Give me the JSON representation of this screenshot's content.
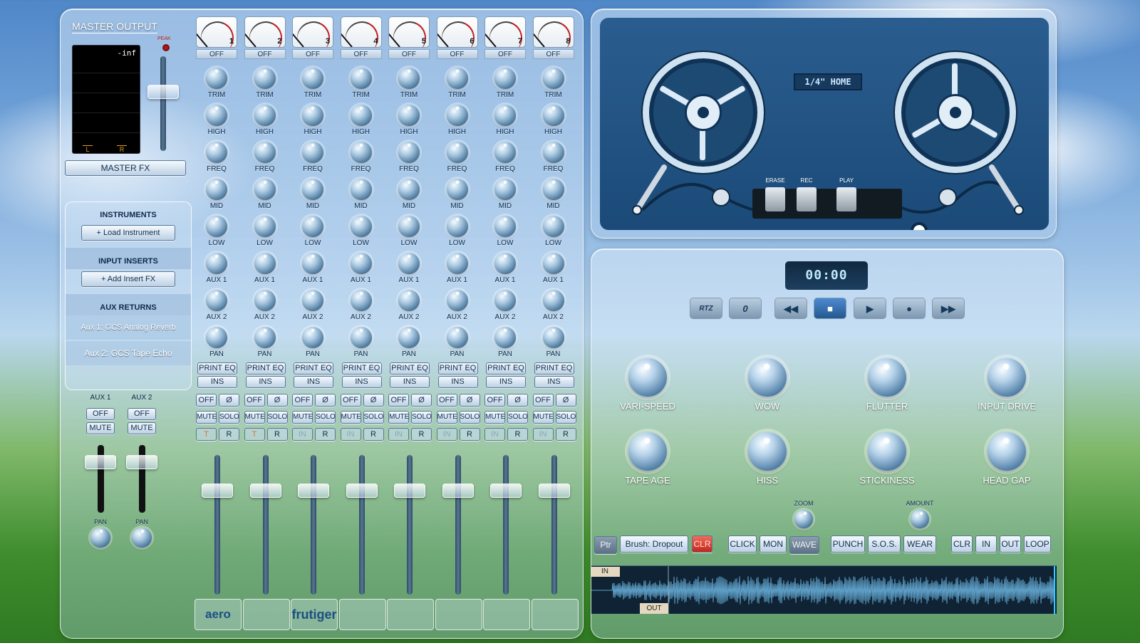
{
  "master": {
    "title": "MASTER OUTPUT",
    "peak": "PEAK",
    "meter_value": "-inf",
    "left": "L",
    "right": "R",
    "fx_button": "MASTER FX"
  },
  "side": {
    "instruments_header": "INSTRUMENTS",
    "load_instrument": "+ Load Instrument",
    "inserts_header": "INPUT INSERTS",
    "add_insert": "+ Add Insert FX",
    "aux_header": "AUX RETURNS",
    "aux1_item": "Aux 1: GCS Analog Reverb",
    "aux2_item": "Aux 2: GCS Tape Echo"
  },
  "aux_returns": [
    {
      "name": "AUX 1",
      "off": "OFF",
      "mute": "MUTE",
      "pan": "PAN"
    },
    {
      "name": "AUX 2",
      "off": "OFF",
      "mute": "MUTE",
      "pan": "PAN"
    }
  ],
  "channels": [
    {
      "num": "1",
      "off": "OFF",
      "trim": "TRIM",
      "high": "HIGH",
      "freq": "FREQ",
      "mid": "MID",
      "low": "LOW",
      "aux1": "AUX 1",
      "aux2": "AUX 2",
      "pan": "PAN",
      "print_eq": "PRINT EQ",
      "ins": "INS",
      "off2": "OFF",
      "phase": "Ø",
      "mute": "MUTE",
      "solo": "SOLO",
      "t": "T",
      "r": "R",
      "strip_label": "aero"
    },
    {
      "num": "2",
      "off": "OFF",
      "trim": "TRIM",
      "high": "HIGH",
      "freq": "FREQ",
      "mid": "MID",
      "low": "LOW",
      "aux1": "AUX 1",
      "aux2": "AUX 2",
      "pan": "PAN",
      "print_eq": "PRINT EQ",
      "ins": "INS",
      "off2": "OFF",
      "phase": "Ø",
      "mute": "MUTE",
      "solo": "SOLO",
      "t": "T",
      "r": "R",
      "strip_label": ""
    },
    {
      "num": "3",
      "off": "OFF",
      "trim": "TRIM",
      "high": "HIGH",
      "freq": "FREQ",
      "mid": "MID",
      "low": "LOW",
      "aux1": "AUX 1",
      "aux2": "AUX 2",
      "pan": "PAN",
      "print_eq": "PRINT EQ",
      "ins": "INS",
      "off2": "OFF",
      "phase": "Ø",
      "mute": "MUTE",
      "solo": "SOLO",
      "t": "IN",
      "r": "R",
      "strip_label": "frutiger"
    },
    {
      "num": "4",
      "off": "OFF",
      "trim": "TRIM",
      "high": "HIGH",
      "freq": "FREQ",
      "mid": "MID",
      "low": "LOW",
      "aux1": "AUX 1",
      "aux2": "AUX 2",
      "pan": "PAN",
      "print_eq": "PRINT EQ",
      "ins": "INS",
      "off2": "OFF",
      "phase": "Ø",
      "mute": "MUTE",
      "solo": "SOLO",
      "t": "IN",
      "r": "R",
      "strip_label": ""
    },
    {
      "num": "5",
      "off": "OFF",
      "trim": "TRIM",
      "high": "HIGH",
      "freq": "FREQ",
      "mid": "MID",
      "low": "LOW",
      "aux1": "AUX 1",
      "aux2": "AUX 2",
      "pan": "PAN",
      "print_eq": "PRINT EQ",
      "ins": "INS",
      "off2": "OFF",
      "phase": "Ø",
      "mute": "MUTE",
      "solo": "SOLO",
      "t": "IN",
      "r": "R",
      "strip_label": ""
    },
    {
      "num": "6",
      "off": "OFF",
      "trim": "TRIM",
      "high": "HIGH",
      "freq": "FREQ",
      "mid": "MID",
      "low": "LOW",
      "aux1": "AUX 1",
      "aux2": "AUX 2",
      "pan": "PAN",
      "print_eq": "PRINT EQ",
      "ins": "INS",
      "off2": "OFF",
      "phase": "Ø",
      "mute": "MUTE",
      "solo": "SOLO",
      "t": "IN",
      "r": "R",
      "strip_label": ""
    },
    {
      "num": "7",
      "off": "OFF",
      "trim": "TRIM",
      "high": "HIGH",
      "freq": "FREQ",
      "mid": "MID",
      "low": "LOW",
      "aux1": "AUX 1",
      "aux2": "AUX 2",
      "pan": "PAN",
      "print_eq": "PRINT EQ",
      "ins": "INS",
      "off2": "OFF",
      "phase": "Ø",
      "mute": "MUTE",
      "solo": "SOLO",
      "t": "IN",
      "r": "R",
      "strip_label": ""
    },
    {
      "num": "8",
      "off": "OFF",
      "trim": "TRIM",
      "high": "HIGH",
      "freq": "FREQ",
      "mid": "MID",
      "low": "LOW",
      "aux1": "AUX 1",
      "aux2": "AUX 2",
      "pan": "PAN",
      "print_eq": "PRINT EQ",
      "ins": "INS",
      "off2": "OFF",
      "phase": "Ø",
      "mute": "MUTE",
      "solo": "SOLO",
      "t": "IN",
      "r": "R",
      "strip_label": ""
    }
  ],
  "tape": {
    "format": "1/4\" HOME",
    "erase": "ERASE",
    "rec": "REC",
    "play": "PLAY"
  },
  "transport": {
    "time": "00:00",
    "rtz": "RTZ",
    "zero": "0",
    "rewind": "◀◀",
    "stop": "■",
    "play": "▶",
    "record": "●",
    "ffwd": "▶▶"
  },
  "tape_knobs": [
    {
      "label": "VARI-SPEED"
    },
    {
      "label": "WOW"
    },
    {
      "label": "FLUTTER"
    },
    {
      "label": "INPUT DRIVE"
    },
    {
      "label": "TAPE AGE"
    },
    {
      "label": "HISS"
    },
    {
      "label": "STICKINESS"
    },
    {
      "label": "HEAD GAP"
    }
  ],
  "toolbar": {
    "zoom": "ZOOM",
    "amount": "AMOUNT",
    "ptr": "Ptr",
    "brush": "Brush: Dropout",
    "clr": "CLR",
    "click": "CLICK",
    "mon": "MON",
    "wave": "WAVE",
    "punch": "PUNCH",
    "sos": "S.O.S.",
    "wear": "WEAR",
    "clr2": "CLR",
    "in": "IN",
    "out": "OUT",
    "loop": "LOOP"
  },
  "waveform": {
    "in_marker": "IN",
    "out_marker": "OUT"
  },
  "colors": {
    "accent": "#2a6fb8",
    "record_red": "#c0281c",
    "waveform": "#5fa0c8"
  }
}
